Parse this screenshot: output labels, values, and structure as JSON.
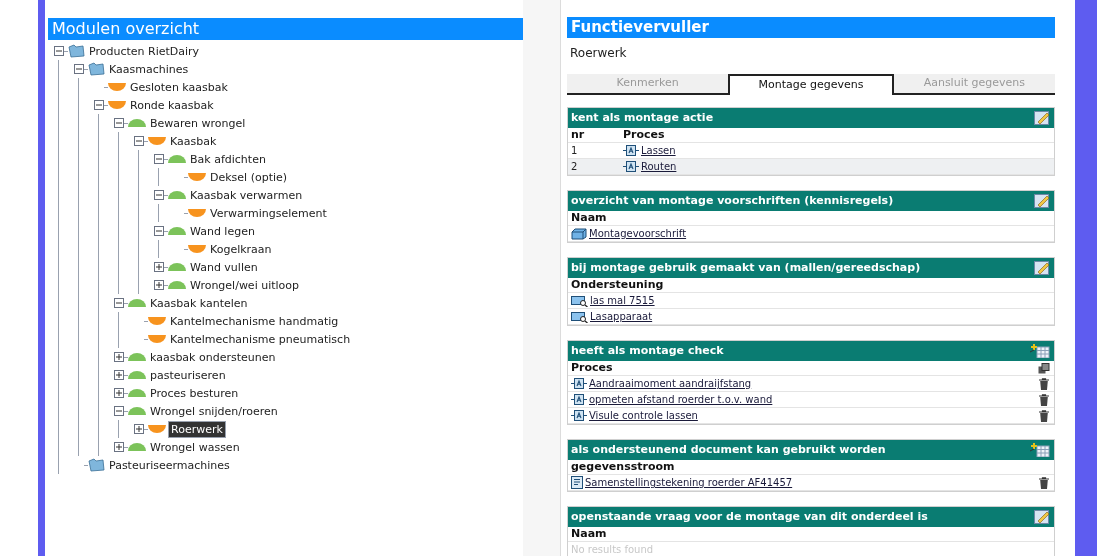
{
  "left_panel": {
    "title": "Modulen overzicht",
    "tree": [
      {
        "label": "Producten RietDairy",
        "kind": "folder",
        "expanded": true,
        "selected": false,
        "children": [
          {
            "label": "Kaasmachines",
            "kind": "folder",
            "expanded": true,
            "selected": false,
            "children": [
              {
                "label": "Gesloten kaasbak",
                "kind": "part",
                "selected": false
              },
              {
                "label": "Ronde kaasbak",
                "kind": "part",
                "expanded": true,
                "selected": false,
                "children": [
                  {
                    "label": "Bewaren wrongel",
                    "kind": "function",
                    "expanded": true,
                    "selected": false,
                    "children": [
                      {
                        "label": "Kaasbak",
                        "kind": "part",
                        "expanded": true,
                        "selected": false,
                        "children": [
                          {
                            "label": "Bak afdichten",
                            "kind": "function",
                            "expanded": true,
                            "selected": false,
                            "children": [
                              {
                                "label": "Deksel (optie)",
                                "kind": "part",
                                "selected": false
                              }
                            ]
                          },
                          {
                            "label": "Kaasbak verwarmen",
                            "kind": "function",
                            "expanded": true,
                            "selected": false,
                            "children": [
                              {
                                "label": "Verwarmingselement",
                                "kind": "part",
                                "selected": false
                              }
                            ]
                          },
                          {
                            "label": "Wand legen",
                            "kind": "function",
                            "expanded": true,
                            "selected": false,
                            "children": [
                              {
                                "label": "Kogelkraan",
                                "kind": "part",
                                "selected": false
                              }
                            ]
                          },
                          {
                            "label": "Wand vullen",
                            "kind": "function",
                            "expanded": false,
                            "selected": false
                          },
                          {
                            "label": "Wrongel/wei uitloop",
                            "kind": "function",
                            "expanded": false,
                            "selected": false
                          }
                        ]
                      }
                    ]
                  },
                  {
                    "label": "Kaasbak kantelen",
                    "kind": "function",
                    "expanded": true,
                    "selected": false,
                    "children": [
                      {
                        "label": "Kantelmechanisme handmatig",
                        "kind": "part",
                        "selected": false
                      },
                      {
                        "label": "Kantelmechanisme pneumatisch",
                        "kind": "part",
                        "selected": false
                      }
                    ]
                  },
                  {
                    "label": "kaasbak ondersteunen",
                    "kind": "function",
                    "expanded": false,
                    "selected": false
                  },
                  {
                    "label": "pasteuriseren",
                    "kind": "function",
                    "expanded": false,
                    "selected": false
                  },
                  {
                    "label": "Proces besturen",
                    "kind": "function",
                    "expanded": false,
                    "selected": false
                  },
                  {
                    "label": "Wrongel snijden/roeren",
                    "kind": "function",
                    "expanded": true,
                    "selected": false,
                    "children": [
                      {
                        "label": "Roerwerk",
                        "kind": "part",
                        "expanded": false,
                        "selected": true
                      }
                    ]
                  },
                  {
                    "label": "Wrongel wassen",
                    "kind": "function",
                    "expanded": false,
                    "selected": false
                  }
                ]
              }
            ]
          },
          {
            "label": "Pasteuriseermachines",
            "kind": "folder",
            "selected": false
          }
        ]
      }
    ]
  },
  "right_panel": {
    "title": "Functievervuller",
    "subtitle": "Roerwerk",
    "tabs": [
      {
        "label": "Kenmerken",
        "selected": false
      },
      {
        "label": "Montage gegevens",
        "selected": true
      },
      {
        "label": "Aansluit gegevens",
        "selected": false
      }
    ],
    "sections": [
      {
        "title": "kent als montage actie",
        "kind": "edit",
        "columns": [
          "nr",
          "Proces"
        ],
        "rows": [
          {
            "nr": "1",
            "kind": "process",
            "text": "Lassen",
            "deletable": false
          },
          {
            "nr": "2",
            "kind": "process",
            "text": "Routen",
            "deletable": false
          }
        ]
      },
      {
        "title": "overzicht van montage voorschriften (kennisregels)",
        "kind": "edit",
        "columns": [
          "Naam"
        ],
        "rows": [
          {
            "kind": "rule",
            "text": "Montagevoorschrift",
            "deletable": false
          }
        ]
      },
      {
        "title": "bij montage gebruik gemaakt van (mallen/gereedschap)",
        "kind": "edit",
        "columns": [
          "Ondersteuning"
        ],
        "rows": [
          {
            "kind": "tool",
            "text": "las mal 7515",
            "deletable": false
          },
          {
            "kind": "tool",
            "text": "Lasapparaat",
            "deletable": false
          }
        ]
      },
      {
        "title": "heeft als montage check",
        "kind": "add",
        "columns": [
          "Proces"
        ],
        "column_tool": true,
        "rows": [
          {
            "kind": "process",
            "text": "Aandraaimoment aandraijfstang",
            "deletable": true
          },
          {
            "kind": "process",
            "text": "opmeten afstand roerder t.o.v. wand",
            "deletable": true
          },
          {
            "kind": "process",
            "text": "Visule controle lassen",
            "deletable": true
          }
        ]
      },
      {
        "title": "als ondersteunend document kan gebruikt worden",
        "kind": "add",
        "columns": [
          "gegevensstroom"
        ],
        "rows": [
          {
            "kind": "document",
            "text": "Samenstellingstekening roerder AF41457",
            "deletable": true
          }
        ]
      },
      {
        "title": "openstaande vraag voor de montage van dit onderdeel is",
        "kind": "edit",
        "columns": [
          "Naam"
        ],
        "empty_text": "No results found"
      }
    ]
  }
}
